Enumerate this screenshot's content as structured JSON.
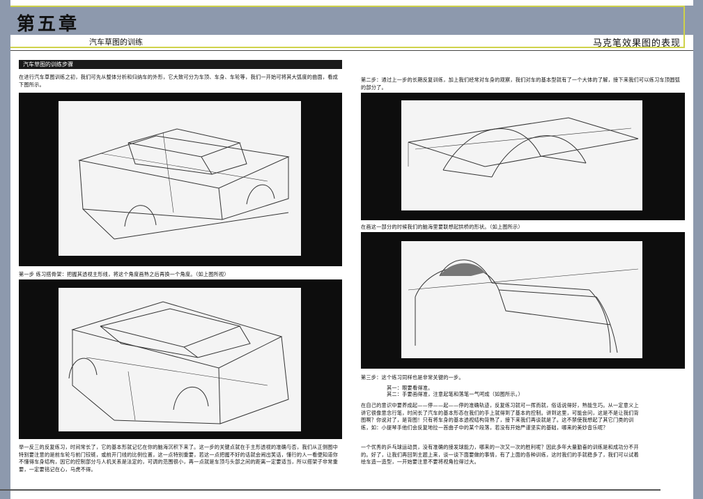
{
  "header": {
    "chapter": "第五章",
    "subtitle_left": "汽车草图的训练",
    "subtitle_right": "马克笔效果图的表现"
  },
  "section_label": "汽车草图的训练步骤",
  "left": {
    "intro": "在进行汽车草图训练之初，我们可先从整体分析和归纳车的外形，它大致可分为车顶、车身、车轮等，我们一开始可将其大弧度的曲面，看成下图所示。",
    "step1": "第一步  练习搭骨架：把握其透视主形线，将这个角度画熟之后再换一个角度。（如上图所视）",
    "closing": "举一反三的反复练习，时间常长了，它的基本形就记忆在你的脑海沉积下来了。这一步的关键点就在于主形透视的准确与否，我们从正侧图中特别要注意的是前车轮与前门铰链，或前开门线的比例位置，这一点特别重要，若这一点把握不好的话就会闹出笑话，懂行的人一看便知道你不懂得车身结构，因它的控制部分与人机关系是法定的，可调的范围很小，再一点就是车顶与头部之间的距离一定要适当，所以搭架子非常重要，一定要铭记在心，马虎不得。"
  },
  "right": {
    "step2": "第二步：通过上一步的长期反复训练，加上我们经常对车身的观察，我们对车的基本型就有了一个大体的了解，接下来我们可以练习车顶圆弧的部分了。",
    "caption2": "在画这一部分的时候我们的脑海里要联想起拱桥的形状。（如上图所示）",
    "step3": "第三步：这个练习同样也是非常关键的一步。",
    "point1": "其一：眼要看得准。",
    "point2": "其二：手要画得准，注意起笔和落笔一气呵成（如图所示。）",
    "para1": "在自己的意识中要养成起——停——起——停的准确轨迹，反复练习就可一挥而就，俗话说得好，熟能生巧。从一定意义上讲它很像意念行笔，时间长了汽车的基本形态在我们的手上就得到了基本的控制。讲到这里，可能会问，这是不是让我们背图啊？你说对了，是背图！只有将车身的基本透视结构背熟了，接下来我们再谈就是了。这不禁使我想起了其它门类的训练，如：小提琴手他们会反复地拉一首曲子中的某个段落，若没有开始严谨坚实的基础，哪来的美妙音乐呢？",
    "para2": "一个优秀的乒乓球运动员，没有准确的接发球能力，哪来的一次又一次的胜利呢？因此多年大量勤奋的训练是和成功分不开的。好了，让我们再回到主题上来，谈一谈下面要做的事情，有了上面的各种训练，这时我们的手就稳多了，我们可以试着绘车造一造型，一开始要注意不要将视角拉得过大。"
  },
  "colors": {
    "band": "#8d99ad",
    "frame_line": "#cfd24a",
    "image_frame": "#0d0d0d"
  }
}
